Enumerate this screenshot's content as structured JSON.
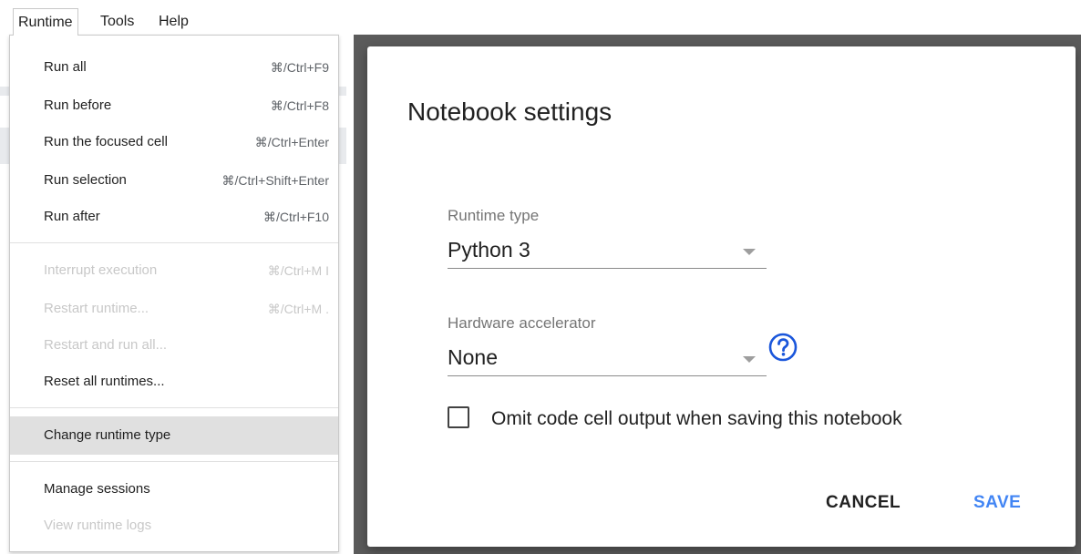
{
  "menubar": {
    "items": [
      "Runtime",
      "Tools",
      "Help"
    ]
  },
  "menu": {
    "items": [
      {
        "label": "Run all",
        "shortcut": "⌘/Ctrl+F9"
      },
      {
        "label": "Run before",
        "shortcut": "⌘/Ctrl+F8"
      },
      {
        "label": "Run the focused cell",
        "shortcut": "⌘/Ctrl+Enter"
      },
      {
        "label": "Run selection",
        "shortcut": "⌘/Ctrl+Shift+Enter"
      },
      {
        "label": "Run after",
        "shortcut": "⌘/Ctrl+F10"
      },
      {
        "label": "Interrupt execution",
        "shortcut": "⌘/Ctrl+M I"
      },
      {
        "label": "Restart runtime...",
        "shortcut": "⌘/Ctrl+M ."
      },
      {
        "label": "Restart and run all...",
        "shortcut": ""
      },
      {
        "label": "Reset all runtimes...",
        "shortcut": ""
      },
      {
        "label": "Change runtime type",
        "shortcut": ""
      },
      {
        "label": "Manage sessions",
        "shortcut": ""
      },
      {
        "label": "View runtime logs",
        "shortcut": ""
      }
    ]
  },
  "dialog": {
    "title": "Notebook settings",
    "runtime_type": {
      "label": "Runtime type",
      "value": "Python 3"
    },
    "hardware_accelerator": {
      "label": "Hardware accelerator",
      "value": "None"
    },
    "omit_output": {
      "label": "Omit code cell output when saving this notebook",
      "checked": false
    },
    "cancel_label": "CANCEL",
    "save_label": "SAVE"
  },
  "colors": {
    "accent": "#4285f4",
    "backdrop": "#5b5b5b",
    "menu_highlight": "#e0e0e0",
    "disabled_text": "#c8c8c8"
  },
  "icons": {
    "help": "help-circle-icon",
    "dropdown": "caret-down-icon",
    "checkbox": "checkbox-unchecked-icon"
  }
}
